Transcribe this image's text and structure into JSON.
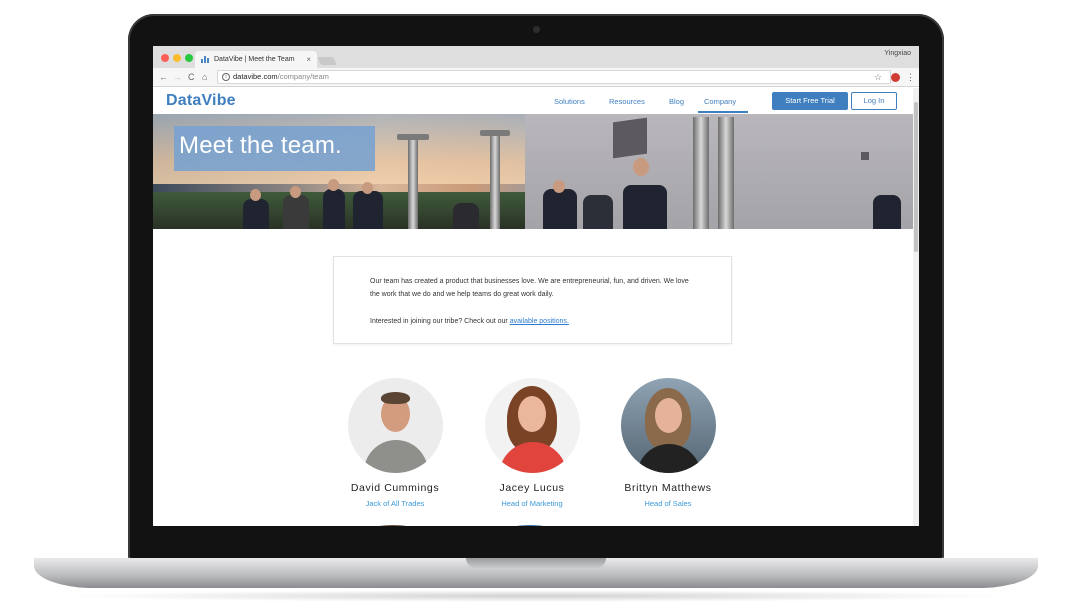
{
  "browser": {
    "tab_title": "DataVibe | Meet the Team",
    "tab_close": "×",
    "user_name": "Yingxiao",
    "url_host": "datavibe.com",
    "url_path": "/company/team",
    "icons": {
      "back": "←",
      "forward": "→",
      "reload": "C",
      "home": "⌂",
      "info": "i",
      "star": "☆",
      "menu": "⋮"
    }
  },
  "site": {
    "logo": "DataVibe",
    "nav": {
      "solutions": "Solutions",
      "resources": "Resources",
      "blog": "Blog",
      "company": "Company"
    },
    "cta_trial": "Start Free Trial",
    "cta_login": "Log In",
    "brand_color": "#3f7fbf"
  },
  "hero": {
    "title": "Meet the team."
  },
  "about": {
    "text": "Our team has created a product that businesses love. We are entrepreneurial, fun, and driven. We love the work that we do and we help teams do great work daily.",
    "join_prefix": "Interested in joining our tribe? Check out our ",
    "join_link": "available positions."
  },
  "team": [
    {
      "name": "David Cummings",
      "role": "Jack of All Trades"
    },
    {
      "name": "Jacey Lucus",
      "role": "Head of Marketing"
    },
    {
      "name": "Brittyn Matthews",
      "role": "Head of Sales"
    }
  ]
}
